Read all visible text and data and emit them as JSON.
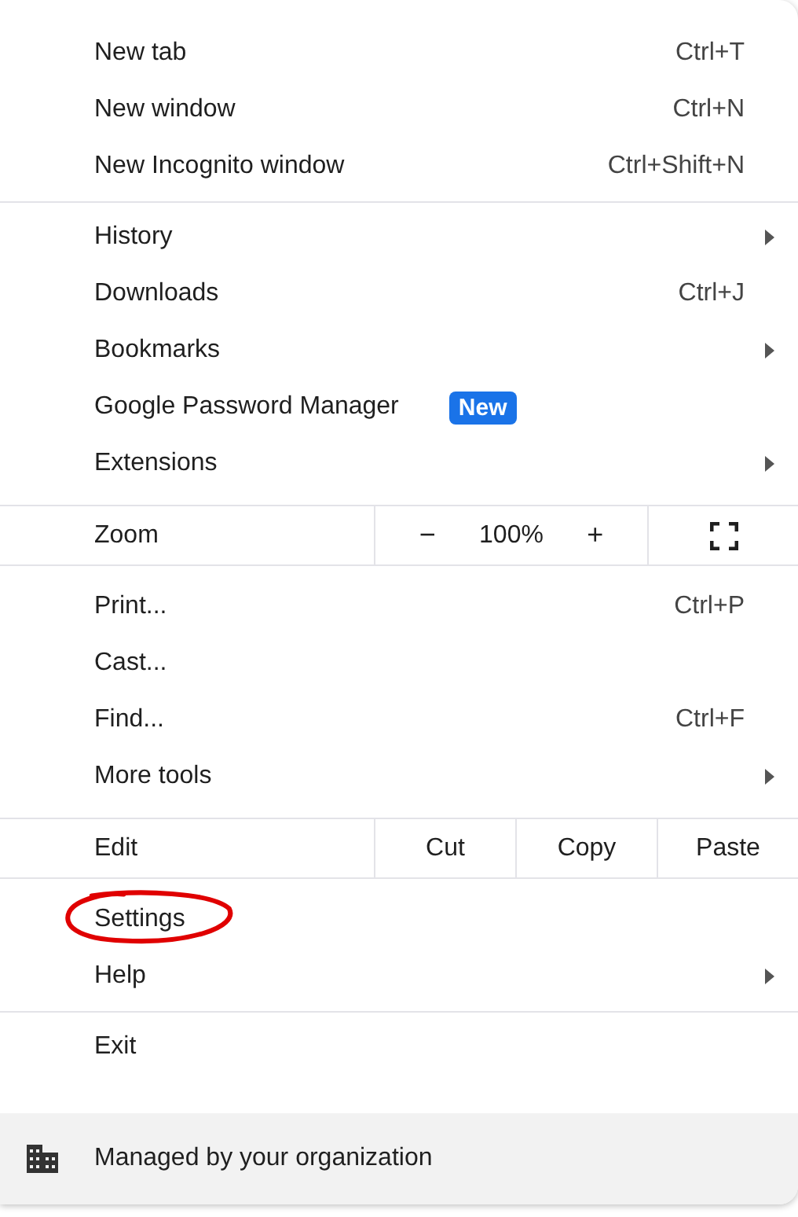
{
  "sections": [
    {
      "items": [
        {
          "kind": "item",
          "label": "New tab",
          "shortcut": "Ctrl+T",
          "submenu": false,
          "circled": false
        },
        {
          "kind": "item",
          "label": "New window",
          "shortcut": "Ctrl+N",
          "submenu": false,
          "circled": false
        },
        {
          "kind": "item",
          "label": "New Incognito window",
          "shortcut": "Ctrl+Shift+N",
          "submenu": false,
          "circled": false
        }
      ]
    },
    {
      "items": [
        {
          "kind": "item",
          "label": "History",
          "submenu": true,
          "circled": false
        },
        {
          "kind": "item",
          "label": "Downloads",
          "shortcut": "Ctrl+J",
          "submenu": false,
          "circled": false
        },
        {
          "kind": "item",
          "label": "Bookmarks",
          "submenu": true,
          "circled": false
        },
        {
          "kind": "item",
          "label": "Google Password Manager",
          "badge": "New",
          "submenu": false,
          "circled": false
        },
        {
          "kind": "item",
          "label": "Extensions",
          "submenu": true,
          "circled": false
        }
      ]
    },
    {
      "items": [
        {
          "kind": "zoom",
          "label": "Zoom",
          "minus": "−",
          "value": "100%",
          "plus": "+"
        }
      ]
    },
    {
      "items": [
        {
          "kind": "item",
          "label": "Print...",
          "shortcut": "Ctrl+P",
          "submenu": false,
          "circled": false
        },
        {
          "kind": "item",
          "label": "Cast...",
          "submenu": false,
          "circled": false
        },
        {
          "kind": "item",
          "label": "Find...",
          "shortcut": "Ctrl+F",
          "submenu": false,
          "circled": false
        },
        {
          "kind": "item",
          "label": "More tools",
          "submenu": true,
          "circled": false
        }
      ]
    },
    {
      "items": [
        {
          "kind": "edit",
          "label": "Edit",
          "actions": [
            "Cut",
            "Copy",
            "Paste"
          ]
        }
      ]
    },
    {
      "items": [
        {
          "kind": "item",
          "label": "Settings",
          "submenu": false,
          "circled": true
        },
        {
          "kind": "item",
          "label": "Help",
          "submenu": true,
          "circled": false
        }
      ]
    },
    {
      "items": [
        {
          "kind": "item",
          "label": "Exit",
          "submenu": false,
          "circled": false
        }
      ]
    }
  ],
  "footer": {
    "text": "Managed by your organization"
  }
}
